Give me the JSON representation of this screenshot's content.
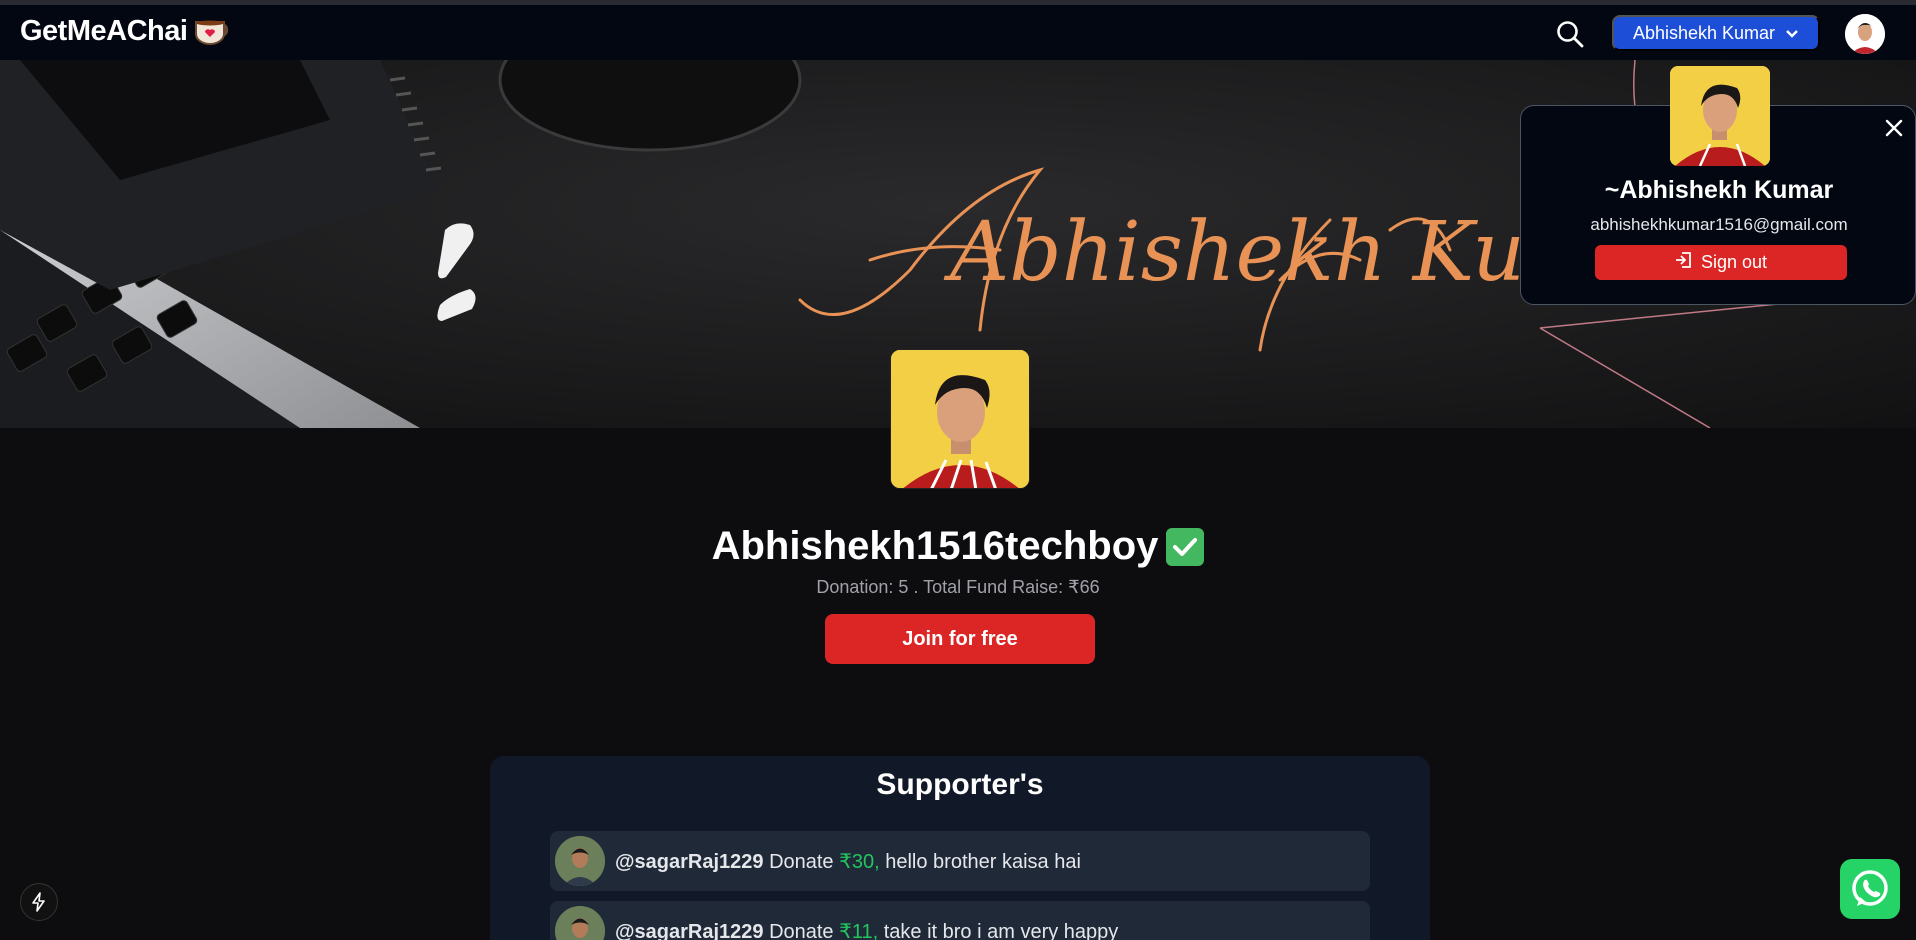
{
  "navbar": {
    "logo_text": "GetMeAChai",
    "user_button_label": "Abhishekh Kumar"
  },
  "banner": {
    "signature_text": "Abhishekh Kumar"
  },
  "profile": {
    "username": "Abhishekh1516techboy",
    "stats": "Donation: 5 . Total Fund Raise: ₹66",
    "join_label": "Join for free"
  },
  "supporters": {
    "title": "Supporter's",
    "items": [
      {
        "handle": "@sagarRaj1229",
        "verb": "Donate",
        "amount": "₹30,",
        "message": "hello brother kaisa hai"
      },
      {
        "handle": "@sagarRaj1229",
        "verb": "Donate",
        "amount": "₹11,",
        "message": "take it bro i am very happy"
      }
    ]
  },
  "popup": {
    "name": "~Abhishekh Kumar",
    "email": "abhishekhkumar1516@gmail.com",
    "signout_label": "Sign out"
  },
  "icons": {
    "search": "search-icon",
    "chevron": "chevron-down-icon",
    "close": "close-icon",
    "signout": "logout-icon",
    "bolt": "bolt-icon",
    "whatsapp": "whatsapp-icon",
    "verified": "check-icon"
  },
  "colors": {
    "accent_blue": "#1d4ed8",
    "accent_red": "#dc2626",
    "amount_green": "#22c55e"
  }
}
